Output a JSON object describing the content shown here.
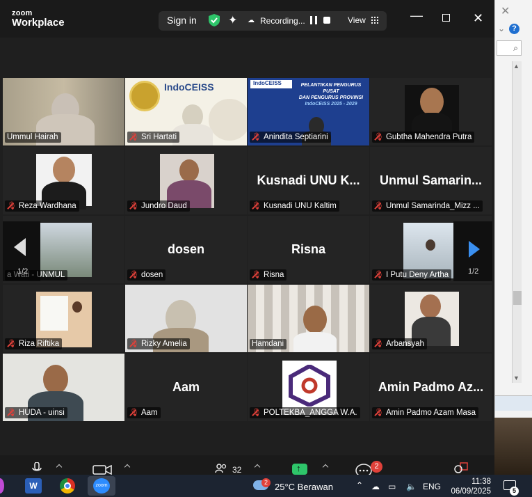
{
  "app": {
    "brand_small": "zoom",
    "brand_big": "Workplace"
  },
  "titlebar": {
    "sign_in": "Sign in",
    "recording": "Recording...",
    "view": "View",
    "icons": [
      "shield-check-icon",
      "sparkle-icon",
      "recording-cloud-icon",
      "pause-icon",
      "stop-icon",
      "grid-icon"
    ]
  },
  "window_controls": {
    "minimize": "—",
    "close": "✕"
  },
  "gallery": {
    "page": "1/2",
    "tiles": [
      {
        "name": "Ummul Hairah",
        "type": "video",
        "muted": false,
        "active": true
      },
      {
        "name": "Sri Hartati",
        "type": "video",
        "muted": true
      },
      {
        "name": "Anindita Septiarini",
        "type": "video",
        "muted": true
      },
      {
        "name": "Gubtha Mahendra Putra",
        "type": "video",
        "muted": true
      },
      {
        "name": "Reza Wardhana",
        "type": "video",
        "muted": true
      },
      {
        "name": "Jundro Daud",
        "type": "video",
        "muted": true
      },
      {
        "name": "Kusnadi UNU Kaltim",
        "display": "Kusnadi UNU K...",
        "type": "name",
        "muted": true
      },
      {
        "name": "Unmul Samarinda_Mizz ...",
        "display": "Unmul Samarin...",
        "type": "name",
        "muted": true
      },
      {
        "name": "a Wati - UNMUL",
        "type": "video",
        "muted": false
      },
      {
        "name": "dosen",
        "display": "dosen",
        "type": "name",
        "muted": true
      },
      {
        "name": "Risna",
        "display": "Risna",
        "type": "name",
        "muted": true
      },
      {
        "name": "I Putu Deny Artha",
        "type": "video",
        "muted": true
      },
      {
        "name": "Riza Riftika",
        "type": "video",
        "muted": true
      },
      {
        "name": "Rizky Amelia",
        "type": "video",
        "muted": true
      },
      {
        "name": "Hamdani",
        "type": "video",
        "muted": false
      },
      {
        "name": "Arbansyah",
        "type": "video",
        "muted": true
      },
      {
        "name": "HUDA - uinsi",
        "type": "video",
        "muted": true
      },
      {
        "name": "Aam",
        "display": "Aam",
        "type": "name",
        "muted": true
      },
      {
        "name": "POLTEKBA_ANGGA W.A.",
        "type": "video",
        "muted": true
      },
      {
        "name": "Amin Padmo Azam Masa",
        "display": "Amin Padmo Az...",
        "type": "name",
        "muted": true
      }
    ],
    "banners": {
      "indoceiss": "IndoCEISS",
      "pelantikan_line1": "PELANTIKAN PENGURUS PUSAT",
      "pelantikan_line2": "DAN PENGURUS PROVINSI",
      "pelantikan_line3": "IndoCEISS 2025 - 2029"
    }
  },
  "toolbar": {
    "participants_count": "32",
    "reactions_badge": "2"
  },
  "taskbar": {
    "weather_badge": "2",
    "weather": "25°C Berawan",
    "lang": "ENG",
    "time": "11:38",
    "date": "06/09/2025",
    "notif_count": "5",
    "zoom_label": "zoom",
    "word_label": "W"
  },
  "colors": {
    "active_outline": "#38d26a",
    "muted_red": "#e0413a",
    "accent_blue": "#3a8ff0"
  }
}
